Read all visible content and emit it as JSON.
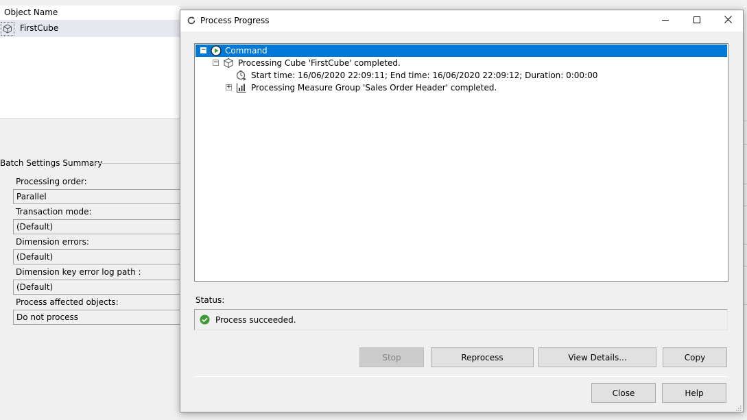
{
  "background": {
    "object_list": {
      "header": "Object Name",
      "items": [
        {
          "name": "FirstCube",
          "icon": "cube-icon"
        }
      ]
    },
    "batch_settings": {
      "title": "Batch Settings Summary",
      "fields": [
        {
          "label": "Processing order:",
          "value": "Parallel"
        },
        {
          "label": "Transaction mode:",
          "value": "(Default)"
        },
        {
          "label": "Dimension errors:",
          "value": "(Default)"
        },
        {
          "label": "Dimension key error log path :",
          "value": "(Default)"
        },
        {
          "label": "Process affected objects:",
          "value": "Do not process"
        }
      ]
    }
  },
  "dialog": {
    "title": "Process Progress",
    "title_icon": "process-refresh-icon",
    "window_buttons": {
      "minimize": "minimize-icon",
      "maximize": "maximize-icon",
      "close": "close-icon"
    },
    "tree": [
      {
        "text": "Command",
        "icon": "command-run-icon",
        "expander": "−",
        "selected": true
      },
      {
        "text": "Processing Cube 'FirstCube' completed.",
        "icon": "cube-icon",
        "expander": "−",
        "selected": false
      },
      {
        "text": "Start time: 16/06/2020 22:09:11; End time: 16/06/2020 22:09:12; Duration: 0:00:00",
        "icon": "timer-icon",
        "expander": "",
        "selected": false
      },
      {
        "text": "Processing Measure Group 'Sales Order Header' completed.",
        "icon": "measure-group-icon",
        "expander": "+",
        "selected": false
      }
    ],
    "status": {
      "label": "Status:",
      "text": "Process succeeded.",
      "icon": "success-check-icon",
      "color": "#3c9b35"
    },
    "buttons": {
      "stop": "Stop",
      "reprocess": "Reprocess",
      "view_details": "View Details...",
      "copy": "Copy",
      "close": "Close",
      "help": "Help"
    },
    "colors": {
      "selection": "#0078d7",
      "title_bar": "#ffffff",
      "background": "#f0f0f0"
    }
  }
}
